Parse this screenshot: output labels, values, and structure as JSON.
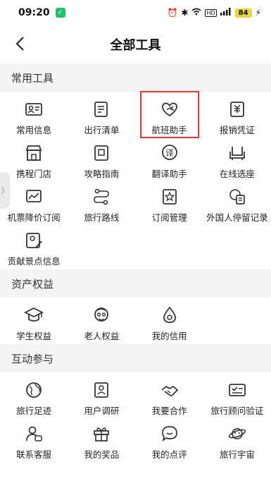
{
  "status": {
    "time": "09:20",
    "battery": "84"
  },
  "header": {
    "title": "全部工具",
    "back_icon": "chevron-left-icon"
  },
  "sections": [
    {
      "title": "常用工具",
      "items": [
        {
          "label": "常用信息",
          "icon": "id-card-icon"
        },
        {
          "label": "出行清单",
          "icon": "checklist-icon"
        },
        {
          "label": "航班助手",
          "icon": "heart-plane-icon"
        },
        {
          "label": "报销凭证",
          "icon": "receipt-icon"
        },
        {
          "label": "携程门店",
          "icon": "store-icon"
        },
        {
          "label": "攻略指南",
          "icon": "guide-book-icon"
        },
        {
          "label": "翻译助手",
          "icon": "translate-icon"
        },
        {
          "label": "在线选座",
          "icon": "seat-icon"
        },
        {
          "label": "机票降价订阅",
          "icon": "price-chart-icon"
        },
        {
          "label": "旅行路线",
          "icon": "route-icon"
        },
        {
          "label": "订阅管理",
          "icon": "star-bookmark-icon"
        },
        {
          "label": "外国人停留记录",
          "icon": "globe-record-icon"
        },
        {
          "label": "贡献景点信息",
          "icon": "location-edit-icon"
        }
      ]
    },
    {
      "title": "资产权益",
      "items": [
        {
          "label": "学生权益",
          "icon": "graduation-cap-icon"
        },
        {
          "label": "老人权益",
          "icon": "elder-icon"
        },
        {
          "label": "我的信用",
          "icon": "drop-icon"
        }
      ]
    },
    {
      "title": "互动参与",
      "items": [
        {
          "label": "旅行足迹",
          "icon": "globe-icon"
        },
        {
          "label": "用户调研",
          "icon": "survey-icon"
        },
        {
          "label": "我要合作",
          "icon": "handshake-icon"
        },
        {
          "label": "旅行顾问验证",
          "icon": "verify-card-icon"
        },
        {
          "label": "联系客服",
          "icon": "customer-service-icon"
        },
        {
          "label": "我的奖品",
          "icon": "gift-icon"
        },
        {
          "label": "我的点评",
          "icon": "comment-icon"
        },
        {
          "label": "旅行宇宙",
          "icon": "planet-icon"
        }
      ]
    }
  ]
}
